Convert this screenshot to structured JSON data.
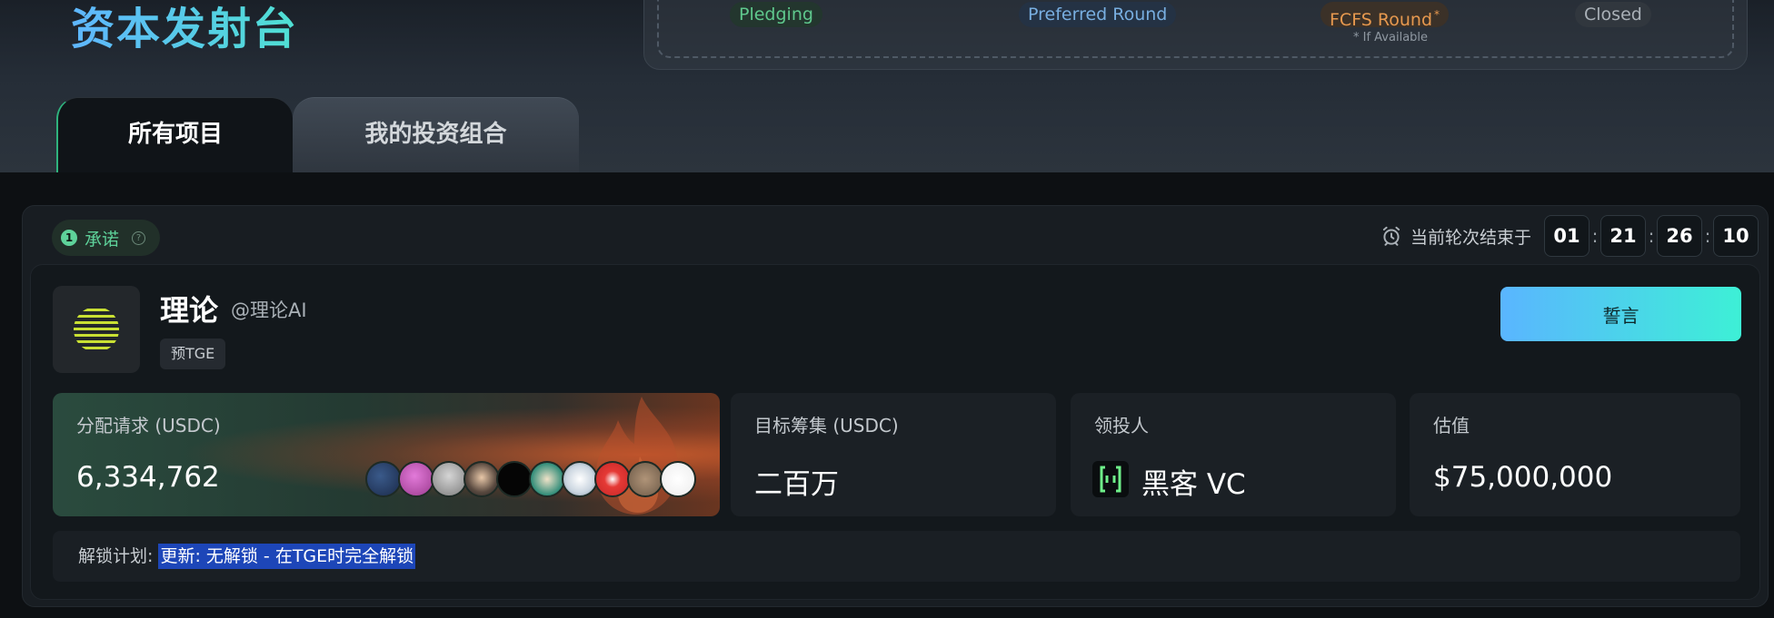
{
  "header": {
    "title": "资本发射台",
    "stages": [
      {
        "label": "Pledging",
        "color": "#5fc88d"
      },
      {
        "label": "Preferred Round",
        "color": "#78aee0"
      },
      {
        "label": "FCFS Round",
        "color": "#e7994f",
        "marker": "*"
      },
      {
        "label": "Closed",
        "color": "#a9b0b7"
      }
    ],
    "fcfs_note": "* If Available"
  },
  "tabs": [
    {
      "label": "所有项目",
      "active": true
    },
    {
      "label": "我的投资组合",
      "active": false
    }
  ],
  "round": {
    "number": "1",
    "label": "承诺",
    "help_icon": "?",
    "timer_label": "当前轮次结束于",
    "timer": [
      "01",
      "21",
      "26",
      "10"
    ]
  },
  "project": {
    "name": "理论",
    "handle": "@理论AI",
    "tag": "预TGE",
    "action_label": "誓言"
  },
  "stats": {
    "allocation": {
      "label": "分配请求 (USDC)",
      "value": "6,334,762",
      "avatar_count": 10
    },
    "target": {
      "label": "目标筹集 (USDC)",
      "value": "二百万"
    },
    "lead": {
      "label": "领投人",
      "value": "黑客 VC"
    },
    "valuation": {
      "label": "估值",
      "value": "$75,000,000"
    }
  },
  "unlock": {
    "label": "解锁计划: ",
    "value": "更新: 无解锁 - 在TGE时完全解锁"
  },
  "colors": {
    "accent_gradient_start": "#5ab5ff",
    "accent_gradient_end": "#3df0d6",
    "background": "#0d1013"
  }
}
